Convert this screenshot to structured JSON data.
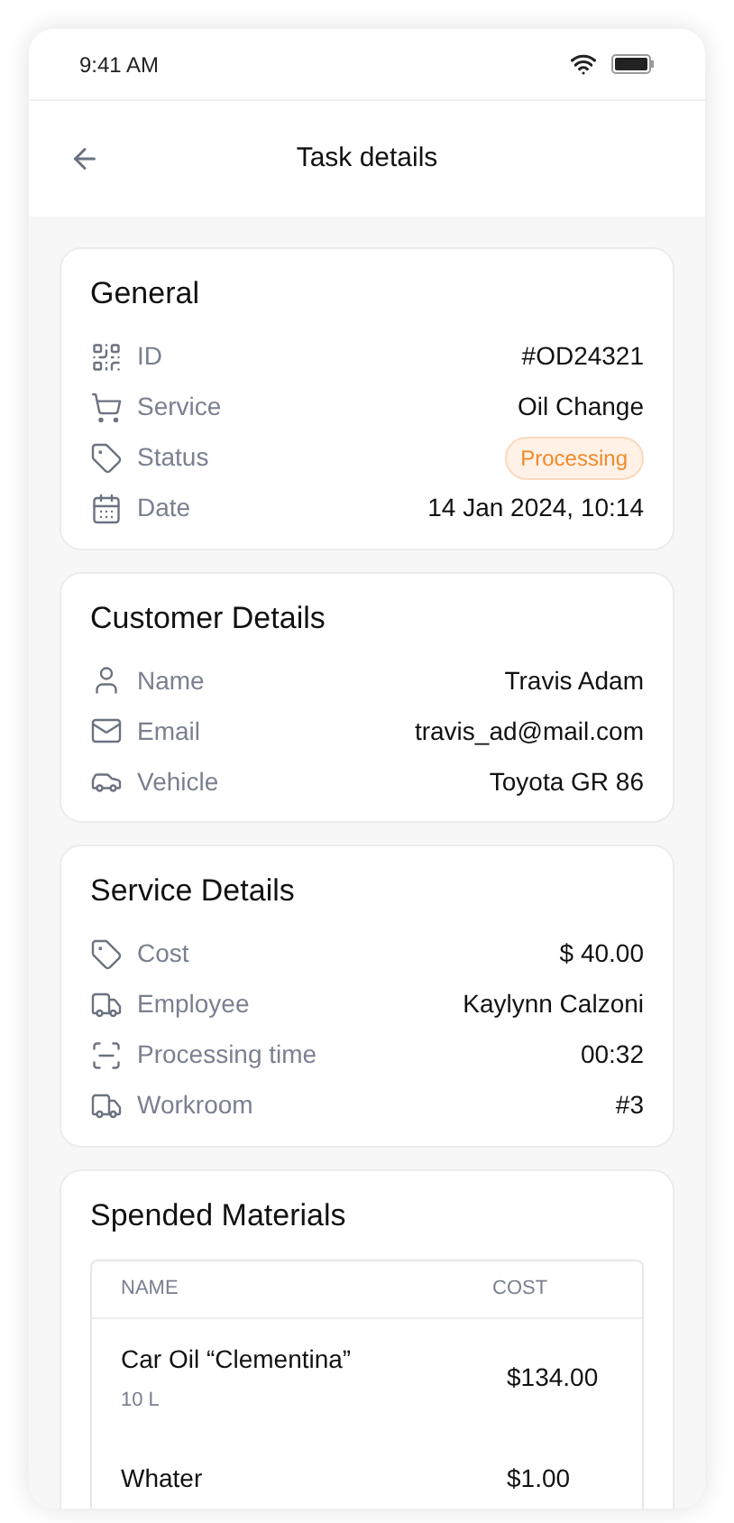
{
  "status_bar": {
    "time": "9:41 AM"
  },
  "header": {
    "title": "Task details"
  },
  "sections": [
    {
      "title": "General",
      "rows": [
        {
          "label": "ID",
          "value": "#OD24321",
          "kind": "text"
        },
        {
          "label": "Service",
          "value": "Oil Change",
          "kind": "text"
        },
        {
          "label": "Status",
          "value": "Processing",
          "kind": "badge"
        },
        {
          "label": "Date",
          "value": "14 Jan 2024, 10:14",
          "kind": "text"
        }
      ]
    },
    {
      "title": "Customer Details",
      "rows": [
        {
          "label": "Name",
          "value": "Travis Adam",
          "kind": "text"
        },
        {
          "label": "Email",
          "value": "travis_ad@mail.com",
          "kind": "text"
        },
        {
          "label": "Vehicle",
          "value": "Toyota GR 86",
          "kind": "text"
        }
      ]
    },
    {
      "title": "Service Details",
      "rows": [
        {
          "label": "Cost",
          "value": "$ 40.00",
          "kind": "text"
        },
        {
          "label": "Employee",
          "value": "Kaylynn Calzoni",
          "kind": "text"
        },
        {
          "label": "Processing time",
          "value": "00:32",
          "kind": "text"
        },
        {
          "label": "Workroom",
          "value": "#3",
          "kind": "text"
        }
      ]
    }
  ],
  "materials": {
    "title": "Spended Materials",
    "columns": [
      "NAME",
      "COST"
    ],
    "rows": [
      {
        "name": "Car Oil “Clementina”",
        "amount": "10 L",
        "cost": "$134.00"
      },
      {
        "name": "Whater",
        "cost": "$1.00"
      }
    ]
  }
}
